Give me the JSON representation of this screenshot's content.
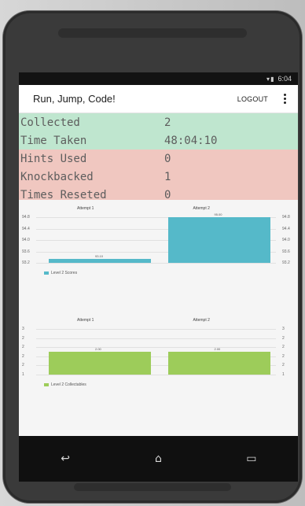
{
  "device": {
    "status": {
      "icons": "▾▮",
      "time": "6:04"
    },
    "nav": {
      "back_icon": "↩",
      "home_icon": "⌂",
      "recent_icon": "▭"
    }
  },
  "app": {
    "title": "Run, Jump, Code!",
    "logout_label": "LOGOUT"
  },
  "stats": {
    "rows": [
      {
        "label": "Collected",
        "value": "2",
        "tone": "good"
      },
      {
        "label": "Time Taken",
        "value": "48:04:10",
        "tone": "good"
      },
      {
        "label": "Hints Used",
        "value": "0",
        "tone": "bad"
      },
      {
        "label": "Knockbacked",
        "value": "1",
        "tone": "bad"
      },
      {
        "label": "Times Reseted",
        "value": "0",
        "tone": "bad"
      }
    ]
  },
  "colors": {
    "scores": "#55b9c9",
    "collectables": "#9dcc5a"
  },
  "chart_data": [
    {
      "type": "bar",
      "title_left": "Attempt 1",
      "title_right": "Attempt 2",
      "categories": [
        "Attempt 1",
        "Attempt 2"
      ],
      "series": [
        {
          "name": "Level 2 Scores",
          "values": [
            93.1,
            95.0
          ]
        }
      ],
      "left_axis_ticks": [
        "94.8",
        "94.4",
        "94.0",
        "93.6",
        "93.2"
      ],
      "right_axis_ticks": [
        "94.8",
        "94.4",
        "94.0",
        "93.6",
        "93.2"
      ],
      "ylim": [
        93.0,
        95.0
      ],
      "data_labels": [
        "93.10",
        "95.00"
      ],
      "legend_placement": "bottom-left"
    },
    {
      "type": "bar",
      "title_left": "Attempt 1",
      "title_right": "Attempt 2",
      "categories": [
        "Attempt 1",
        "Attempt 2"
      ],
      "series": [
        {
          "name": "Level 2 Collectables",
          "values": [
            2,
            2
          ]
        }
      ],
      "left_axis_ticks": [
        "3",
        "2",
        "2",
        "2",
        "2",
        "1"
      ],
      "right_axis_ticks": [
        "3",
        "2",
        "2",
        "2",
        "2",
        "1"
      ],
      "ylim": [
        1,
        3
      ],
      "data_labels": [
        "2.00",
        "2.00"
      ],
      "legend_placement": "bottom-left"
    }
  ]
}
